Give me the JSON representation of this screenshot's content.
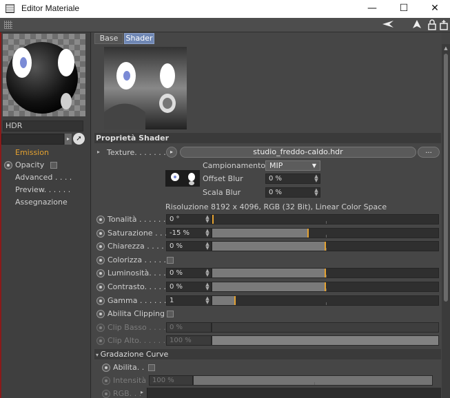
{
  "window": {
    "title": "Editor Materiale",
    "minimize": "—",
    "maximize": "☐",
    "close": "✕"
  },
  "toolbar": {
    "icons": [
      "back-arrow-icon",
      "cursor-icon",
      "lock-icon",
      "new-window-icon"
    ]
  },
  "left": {
    "material_name": "HDR",
    "channels": [
      {
        "label": "Emission",
        "active": true
      },
      {
        "label": "Opacity",
        "active": false
      },
      {
        "label": "Advanced . . . .",
        "active": false
      },
      {
        "label": "Preview. . . . . .",
        "active": false
      },
      {
        "label": "Assegnazione",
        "active": false
      }
    ]
  },
  "tabs": [
    "Base",
    "Shader"
  ],
  "active_tab": "Shader",
  "shader": {
    "section_title": "Proprietà Shader",
    "texture_label": "Texture. . . . . . .",
    "texture_file": "studio_freddo-caldo.hdr",
    "more_button": "...",
    "sampling_label": "Campionamento",
    "sampling_value": "MIP",
    "offset_blur_label": "Offset Blur",
    "offset_blur_value": "0 %",
    "scale_blur_label": "Scala Blur",
    "scale_blur_value": "0 %",
    "resolution_info": "Risoluzione 8192 x 4096, RGB (32 Bit), Linear Color Space"
  },
  "params": [
    {
      "label": "Tonalità . . . . . .",
      "value": "0 °",
      "fraction": 0.0
    },
    {
      "label": "Saturazione . . .",
      "value": "-15 %",
      "fraction": 0.425
    },
    {
      "label": "Chiarezza . . . . .",
      "value": "0 %",
      "fraction": 0.5
    },
    {
      "label": "Colorizza . . . . .",
      "checkbox": true
    },
    {
      "label": "Luminosità. . . . .",
      "value": "0 %",
      "fraction": 0.5
    },
    {
      "label": "Contrasto. . . . . .",
      "value": "0 %",
      "fraction": 0.5
    },
    {
      "label": "Gamma . . . . . . .",
      "value": "1",
      "fraction": 0.1
    },
    {
      "label": "Abilita Clipping",
      "checkbox": true
    },
    {
      "label": "Clip Basso . . . . .",
      "value": "0 %",
      "fraction": 0.0,
      "disabled": true
    },
    {
      "label": "Clip Alto. . . . . . .",
      "value": "100 %",
      "fraction": 1.0,
      "disabled": true
    }
  ],
  "curves": {
    "section_title": "Gradazione Curve",
    "enable_label": "Abilita. .",
    "intensity_label": "Intensità",
    "intensity_value": "100 %",
    "rgb_label": "RGB. . ."
  }
}
